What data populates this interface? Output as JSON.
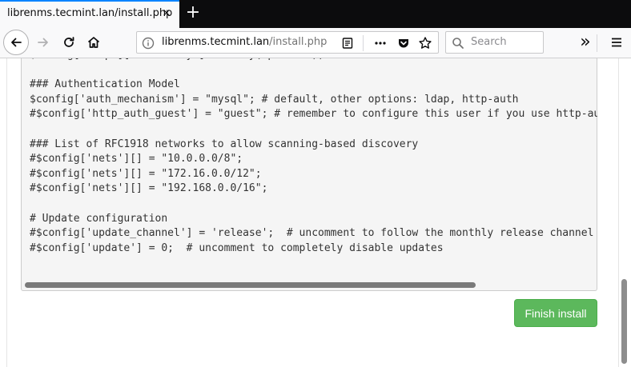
{
  "browser": {
    "tab": {
      "title": "librenms.tecmint.lan/install.php",
      "close_glyph": "×"
    },
    "new_tab_glyph": "+",
    "url": {
      "host": "librenms.tecmint.lan",
      "path": "/install.php"
    },
    "search": {
      "placeholder": "Search"
    },
    "overflow_glyph": "»"
  },
  "install_page": {
    "config_lines": [
      "$config['snmp']['community'] = array(\"public\");",
      "",
      "### Authentication Model",
      "$config['auth_mechanism'] = \"mysql\"; # default, other options: ldap, http-auth",
      "#$config['http_auth_guest'] = \"guest\"; # remember to configure this user if you use http-auth",
      "",
      "### List of RFC1918 networks to allow scanning-based discovery",
      "#$config['nets'][] = \"10.0.0.0/8\";",
      "#$config['nets'][] = \"172.16.0.0/12\";",
      "#$config['nets'][] = \"192.168.0.0/16\";",
      "",
      "# Update configuration",
      "#$config['update_channel'] = 'release';  # uncomment to follow the monthly release channel",
      "#$config['update'] = 0;  # uncomment to completely disable updates"
    ],
    "finish_button": "Finish install"
  },
  "colors": {
    "accent_tab": "#0a84ff",
    "finish_button": "#5cb85c"
  }
}
